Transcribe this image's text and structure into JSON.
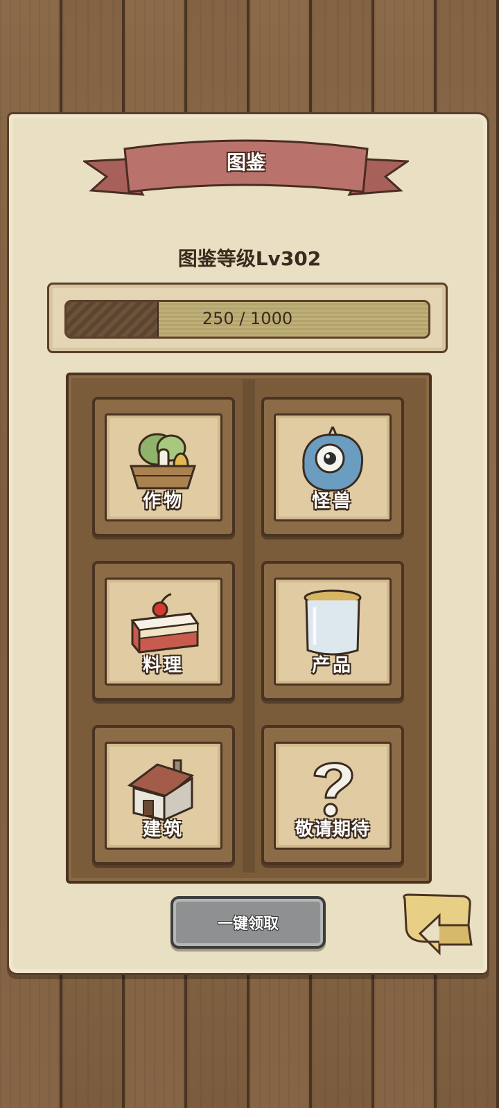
{
  "header": {
    "title": "图鉴"
  },
  "level": {
    "label": "图鉴等级Lv302"
  },
  "progress": {
    "current": 250,
    "max": 1000,
    "text": "250 / 1000"
  },
  "categories": [
    {
      "label": "作物",
      "icon": "crops-basket-icon"
    },
    {
      "label": "怪兽",
      "icon": "monster-eye-icon"
    },
    {
      "label": "料理",
      "icon": "cake-icon"
    },
    {
      "label": "产品",
      "icon": "jar-icon"
    },
    {
      "label": "建筑",
      "icon": "house-icon"
    },
    {
      "label": "敬请期待",
      "icon": "question-mark-icon"
    }
  ],
  "actions": {
    "claim_all": "一键领取"
  },
  "colors": {
    "ribbon": "#b9736c",
    "paper": "#e9dfc3",
    "board": "#7a5b3a",
    "button_gray": "#8e9091",
    "back_yellow": "#e8cf86"
  }
}
